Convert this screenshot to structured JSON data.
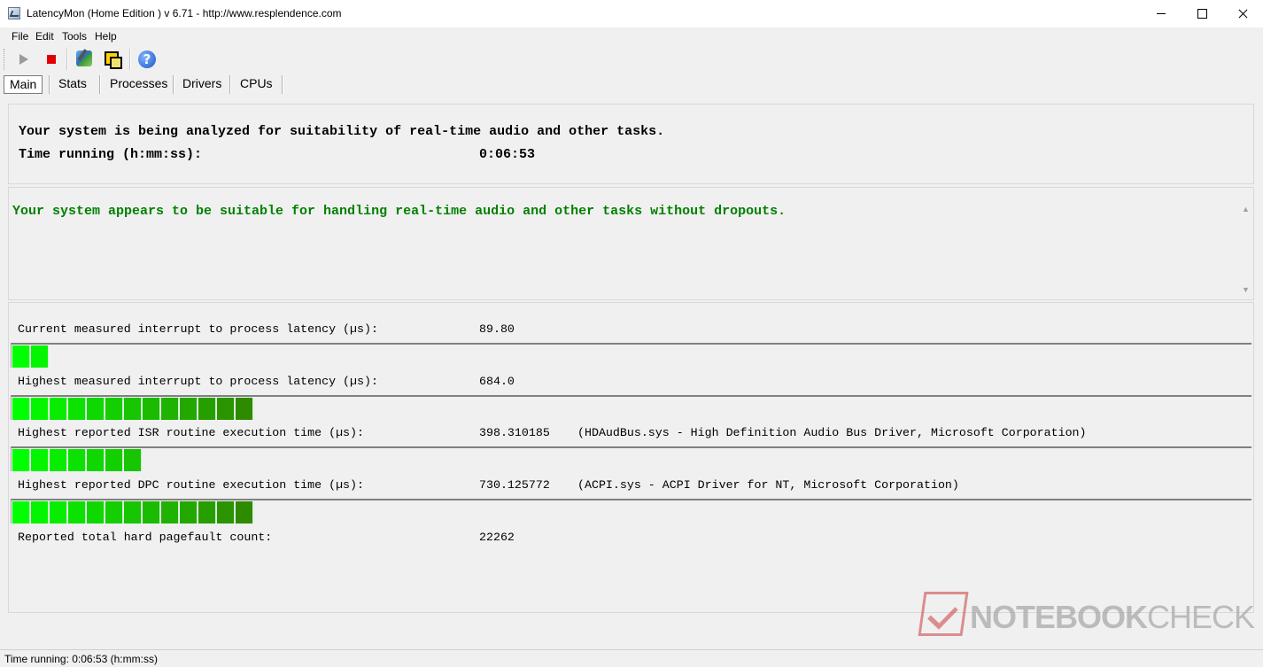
{
  "window": {
    "title": "LatencyMon  (Home Edition )  v 6.71 - http://www.resplendence.com",
    "minimize_icon": "minimize-icon",
    "maximize_icon": "maximize-icon",
    "close_icon": "close-icon"
  },
  "menu": {
    "items": [
      "File",
      "Edit",
      "Tools",
      "Help"
    ]
  },
  "toolbar": {
    "buttons": [
      "play-icon",
      "stop-icon",
      "drivers-icon",
      "windows-icon",
      "help-icon"
    ],
    "help_glyph": "?"
  },
  "tabs": [
    {
      "label": "Main",
      "active": true
    },
    {
      "label": "Stats",
      "active": false
    },
    {
      "label": "Processes",
      "active": false
    },
    {
      "label": "Drivers",
      "active": false
    },
    {
      "label": "CPUs",
      "active": false
    }
  ],
  "status_panel": {
    "analyzing_text": "Your system is being analyzed for suitability of real-time audio and other tasks.",
    "time_label": "Time running (h:mm:ss):",
    "time_value": "0:06:53"
  },
  "verdict": {
    "text": "Your system appears to be suitable for handling real-time audio and other tasks without dropouts.",
    "color": "#008000"
  },
  "metrics": [
    {
      "label": "Current measured interrupt to process latency (µs):",
      "value": "89.80",
      "info": "",
      "segments": 2
    },
    {
      "label": "Highest measured interrupt to process latency (µs):",
      "value": "684.0",
      "info": "",
      "segments": 13
    },
    {
      "label": "Highest reported ISR routine execution time (µs):",
      "value": "398.310185",
      "info": "(HDAudBus.sys - High Definition Audio Bus Driver, Microsoft Corporation)",
      "segments": 7
    },
    {
      "label": "Highest reported DPC routine execution time (µs):",
      "value": "730.125772",
      "info": "(ACPI.sys - ACPI Driver for NT, Microsoft Corporation)",
      "segments": 13
    }
  ],
  "pagefault": {
    "label": "Reported total hard pagefault count:",
    "value": "22262"
  },
  "statusbar": {
    "text": "Time running: 0:06:53  (h:mm:ss)"
  },
  "watermark": {
    "brand_part1": "NOTEBOOK",
    "brand_part2": "CHECK"
  },
  "colors": {
    "bar_start": "#00ff00",
    "bar_end": "#2e8b00"
  }
}
